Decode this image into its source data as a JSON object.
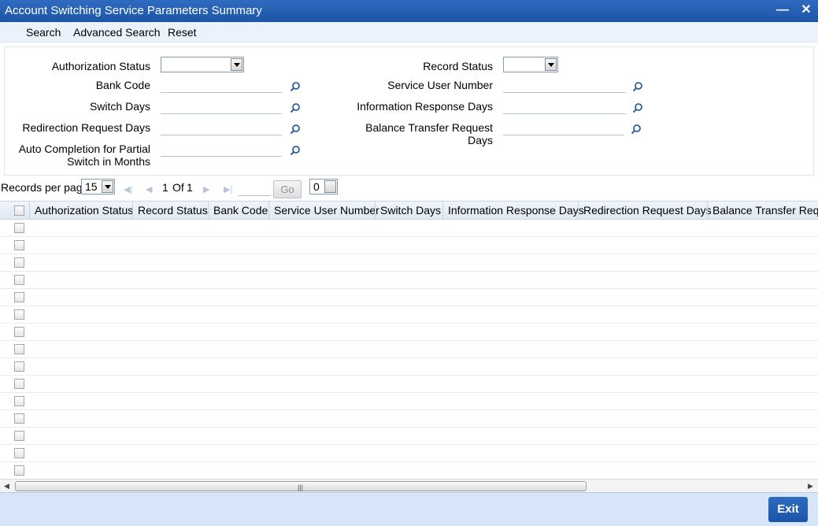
{
  "window": {
    "title": "Account Switching Service Parameters Summary",
    "minimize_icon": "minimize-icon",
    "close_icon": "close-icon"
  },
  "menu": {
    "search": "Search",
    "advanced_search": "Advanced Search",
    "reset": "Reset"
  },
  "form": {
    "authorization_status": "Authorization Status",
    "bank_code": "Bank Code",
    "switch_days": "Switch Days",
    "redirection_request_days": "Redirection Request Days",
    "auto_completion_line1": "Auto Completion for Partial",
    "auto_completion_line2": "Switch in Months",
    "record_status": "Record Status",
    "service_user_number": "Service User Number",
    "information_response_days": "Information Response Days",
    "balance_transfer_line1": "Balance Transfer Request",
    "balance_transfer_line2": "Days",
    "authorization_status_value": "",
    "record_status_value": ""
  },
  "pager": {
    "records_per_page_label": "Records per page",
    "records_per_page_value": "15",
    "page_current": "1",
    "page_of": "Of",
    "page_total": "1",
    "go_label": "Go",
    "jump_value": "0"
  },
  "grid": {
    "columns": [
      "Authorization Status",
      "Record Status",
      "Bank Code",
      "Service User Number",
      "Switch Days",
      "Information Response Days",
      "Redirection Request Days",
      "Balance Transfer Reque"
    ]
  },
  "footer": {
    "exit_label": "Exit"
  },
  "colors": {
    "titlebar": "#1d55a6",
    "footer": "#d6e6f8",
    "exit_button": "#1a54a6"
  }
}
